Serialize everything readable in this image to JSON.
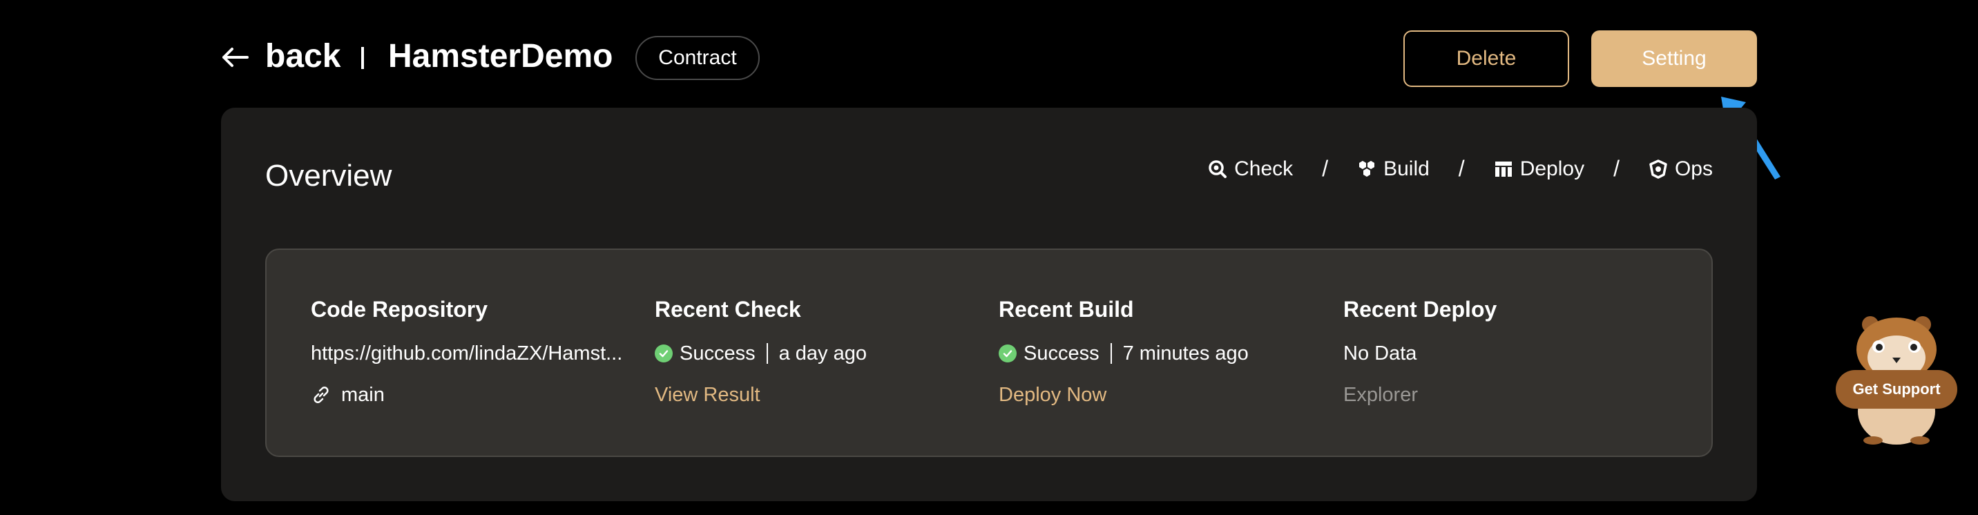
{
  "header": {
    "back_label": "back",
    "app_title": "HamsterDemo",
    "type_tag": "Contract",
    "delete_label": "Delete",
    "setting_label": "Setting"
  },
  "overview": {
    "title": "Overview",
    "steps": [
      {
        "label": "Check",
        "icon": "magnifier-icon"
      },
      {
        "label": "Build",
        "icon": "cubes-icon"
      },
      {
        "label": "Deploy",
        "icon": "grid-icon"
      },
      {
        "label": "Ops",
        "icon": "shield-icon"
      }
    ]
  },
  "summary": {
    "repo": {
      "title": "Code Repository",
      "url": "https://github.com/lindaZX/Hamst...",
      "branch": "main"
    },
    "check": {
      "title": "Recent Check",
      "status": "Success",
      "time": "a day ago",
      "action": "View Result"
    },
    "build": {
      "title": "Recent Build",
      "status": "Success",
      "time": "7 minutes ago",
      "action": "Deploy Now"
    },
    "deploy": {
      "title": "Recent Deploy",
      "status": "No Data",
      "action": "Explorer"
    }
  },
  "support": {
    "label": "Get Support"
  },
  "colors": {
    "accent": "#e2b982",
    "success": "#6fcf74",
    "pointer": "#2f9bf0"
  }
}
